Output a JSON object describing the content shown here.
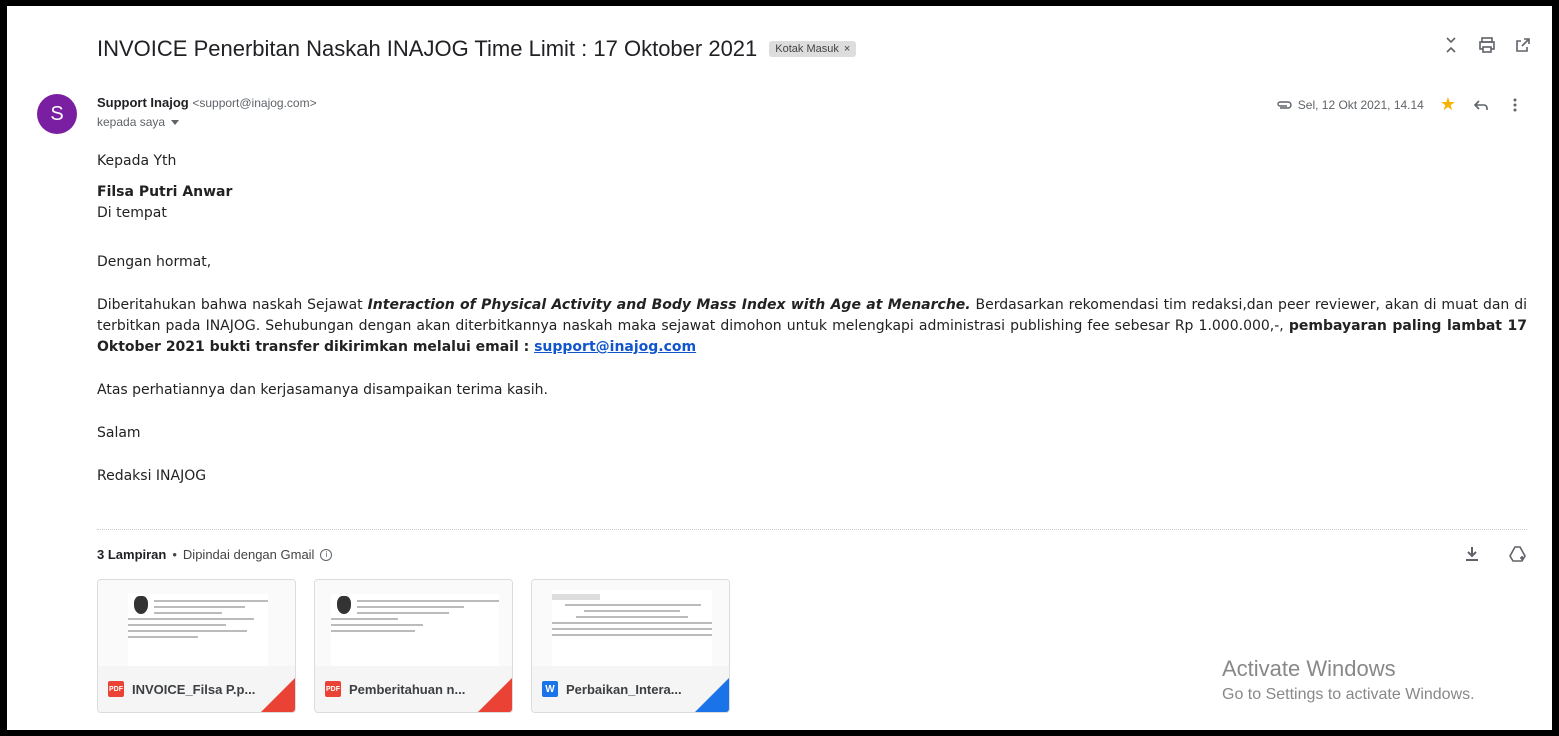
{
  "subject": "INVOICE Penerbitan Naskah INAJOG Time Limit : 17 Oktober 2021",
  "label_chip": "Kotak Masuk",
  "label_chip_close": "×",
  "top_icons": [
    "collapse-icon",
    "print-icon",
    "open-new-window-icon"
  ],
  "avatar_letter": "S",
  "avatar_color": "#7b1fa2",
  "sender": {
    "name": "Support Inajog",
    "email": "<support@inajog.com>",
    "to": "kepada saya"
  },
  "date": "Sel, 12 Okt 2021, 14.14",
  "body": {
    "greeting": "Kepada Yth",
    "recipient_name": "Filsa Putri Anwar",
    "recipient_place": "Di tempat",
    "salutation": "Dengan hormat,",
    "para_intro": "Diberitahukan bahwa naskah Sejawat ",
    "para_title": "Interaction of Physical Activity and Body Mass Index with Age at Menarche.",
    "para_rest": " Berdasarkan rekomendasi tim redaksi,dan peer reviewer,  akan di muat dan di terbitkan pada INAJOG. Sehubungan dengan akan diterbitkannya naskah maka  sejawat dimohon untuk melengkapi administrasi publishing fee sebesar Rp 1.000.000,-, ",
    "para_bold": "pembayaran paling lambat  17 Oktober  2021 bukti transfer dikirimkan melalui email : ",
    "para_link": "support@inajog.com",
    "thanks": "Atas perhatiannya dan kerjasamanya disampaikan terima kasih.",
    "closing": "Salam",
    "signature": "Redaksi INAJOG"
  },
  "attachments": {
    "count_label": "3 Lampiran",
    "separator": "•",
    "scan_label": "Dipindai dengan Gmail",
    "info_glyph": "i",
    "items": [
      {
        "type": "PDF",
        "name": "INVOICE_Filsa P.p...",
        "color": "#ea4335"
      },
      {
        "type": "PDF",
        "name": "Pemberitahuan n...",
        "color": "#ea4335"
      },
      {
        "type": "W",
        "name": "Perbaikan_Intera...",
        "color": "#1a73e8"
      }
    ]
  },
  "watermark": {
    "line1": "Activate Windows",
    "line2": "Go to Settings to activate Windows."
  },
  "colors": {
    "star": "#f4b400",
    "link": "#1155cc"
  }
}
